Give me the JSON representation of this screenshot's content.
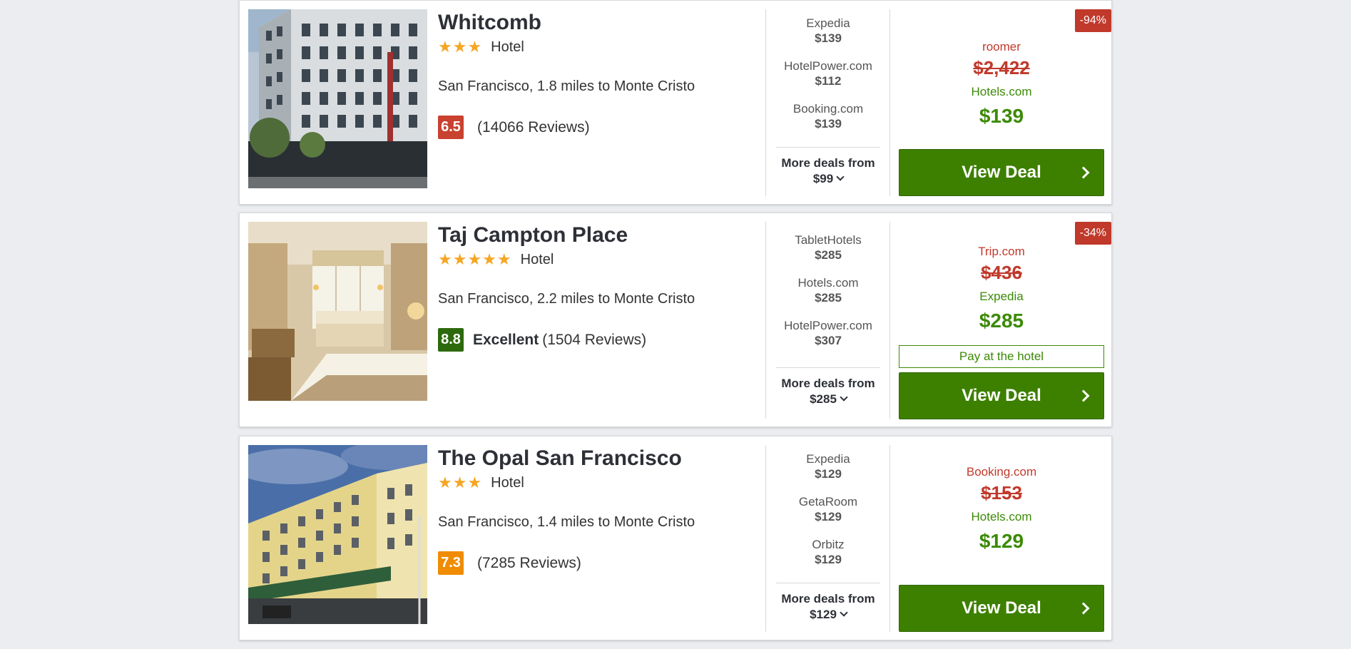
{
  "hotels": [
    {
      "name": "Whitcomb",
      "stars": "★★★",
      "type": "Hotel",
      "location": "San Francisco, 1.8 miles to Monte Cristo",
      "score": "6.5",
      "score_color": "#c9412f",
      "rating_label": "",
      "reviews": "(14066 Reviews)",
      "deals": [
        {
          "provider": "Expedia",
          "price": "$139"
        },
        {
          "provider": "HotelPower.com",
          "price": "$112"
        },
        {
          "provider": "Booking.com",
          "price": "$139"
        }
      ],
      "more_deals": "More deals from",
      "more_price": "$99",
      "discount": "-94%",
      "old_provider": "roomer",
      "old_price": "$2,422",
      "new_provider": "Hotels.com",
      "new_price": "$139",
      "pay_at_hotel": "",
      "button": "View Deal"
    },
    {
      "name": "Taj Campton Place",
      "stars": "★★★★★",
      "type": "Hotel",
      "location": "San Francisco, 2.2 miles to Monte Cristo",
      "score": "8.8",
      "score_color": "#2d6a0d",
      "rating_label": "Excellent",
      "reviews": "(1504 Reviews)",
      "deals": [
        {
          "provider": "TabletHotels",
          "price": "$285"
        },
        {
          "provider": "Hotels.com",
          "price": "$285"
        },
        {
          "provider": "HotelPower.com",
          "price": "$307"
        }
      ],
      "more_deals": "More deals from",
      "more_price": "$285",
      "discount": "-34%",
      "old_provider": "Trip.com",
      "old_price": "$436",
      "new_provider": "Expedia",
      "new_price": "$285",
      "pay_at_hotel": "Pay at the hotel",
      "button": "View Deal"
    },
    {
      "name": "The Opal San Francisco",
      "stars": "★★★",
      "type": "Hotel",
      "location": "San Francisco, 1.4 miles to Monte Cristo",
      "score": "7.3",
      "score_color": "#f08c00",
      "rating_label": "",
      "reviews": "(7285 Reviews)",
      "deals": [
        {
          "provider": "Expedia",
          "price": "$129"
        },
        {
          "provider": "GetaRoom",
          "price": "$129"
        },
        {
          "provider": "Orbitz",
          "price": "$129"
        }
      ],
      "more_deals": "More deals from",
      "more_price": "$129",
      "discount": "",
      "old_provider": "Booking.com",
      "old_price": "$153",
      "new_provider": "Hotels.com",
      "new_price": "$129",
      "pay_at_hotel": "",
      "button": "View Deal"
    }
  ]
}
